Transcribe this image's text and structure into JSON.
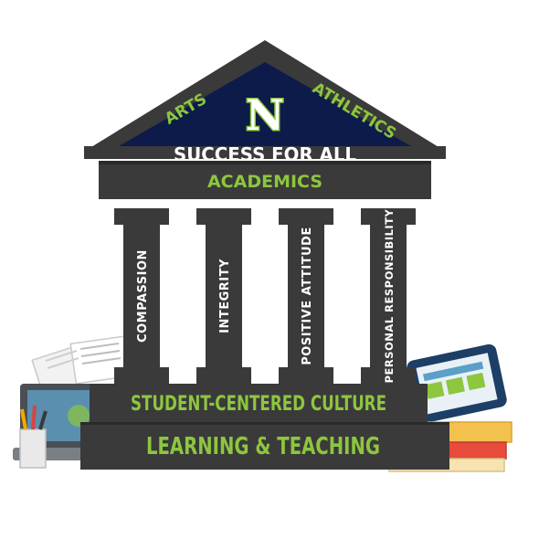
{
  "roof": {
    "logo_letter": "N",
    "title": "SUCCESS FOR ALL",
    "left_label": "ARTS",
    "right_label": "ATHLETICS"
  },
  "entablature": {
    "label": "ACADEMICS"
  },
  "pillars": [
    {
      "label": "COMPASSION"
    },
    {
      "label": "INTEGRITY"
    },
    {
      "label": "POSITIVE ATTITUDE"
    },
    {
      "label": "PERSONAL RESPONSIBILITY"
    }
  ],
  "base": {
    "upper_step": "STUDENT-CENTERED CULTURE",
    "lower_step": "LEARNING & TEACHING"
  },
  "colors": {
    "navy": "#0d1b4a",
    "dark_gray": "#3a3a3a",
    "lime": "#8dc63f",
    "white": "#ffffff"
  }
}
